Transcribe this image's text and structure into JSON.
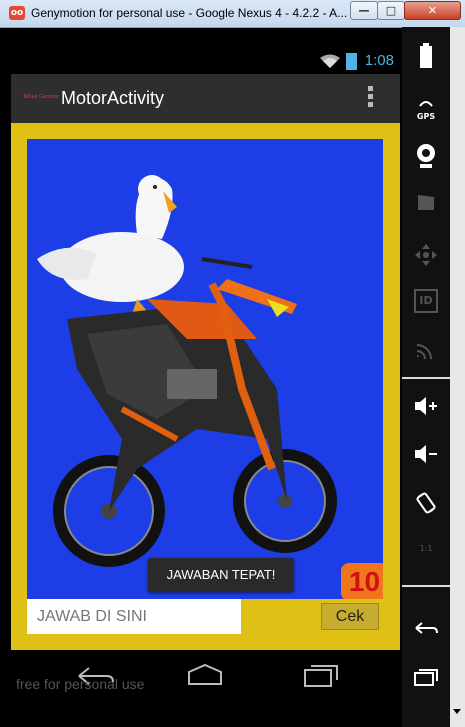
{
  "window": {
    "title": "Genymotion for personal use - Google Nexus 4 - 4.2.2 - A...",
    "app_icon_text": "oo",
    "minimize_glyph": "—",
    "maximize_glyph": "□",
    "close_glyph": "✕"
  },
  "statusbar": {
    "time": "1:08"
  },
  "actionbar": {
    "logo_text": "Tebak Gambar",
    "title": "MotorActivity"
  },
  "game": {
    "toast": "JAWABAN TEPAT!",
    "score": "10",
    "answer_placeholder": "JAWAB DI SINI",
    "check_button": "Cek"
  },
  "sidebar": {
    "gps_label": "GPS",
    "id_label": "ID",
    "ratio_label": "1:1"
  },
  "watermark": "free for personal use",
  "colors": {
    "content_bg": "#dfc015",
    "image_bg": "#1d3de6",
    "score_bg": "#f0761e",
    "score_text": "#d21010",
    "time_text": "#4fb3e6"
  }
}
